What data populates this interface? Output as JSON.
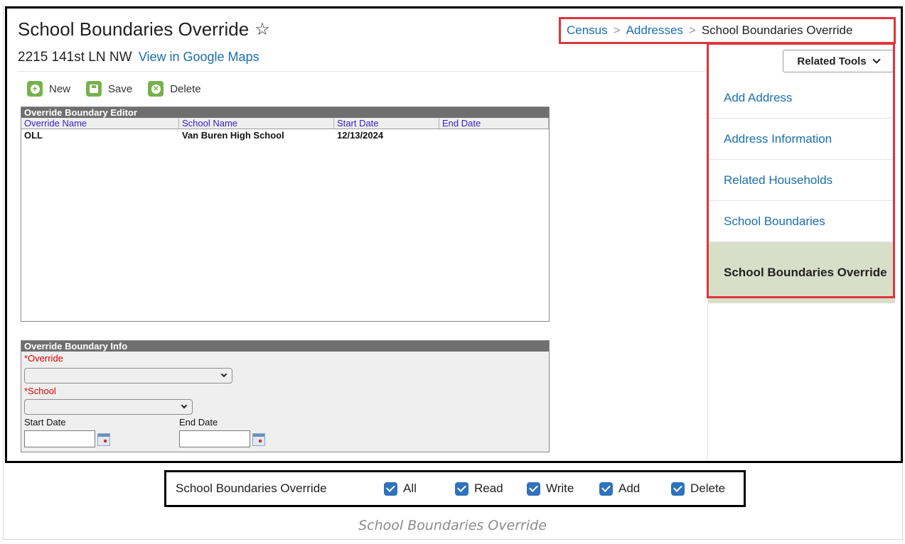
{
  "page": {
    "title": "School Boundaries Override",
    "address": "2215 141st LN NW",
    "maps_link": "View in Google Maps"
  },
  "breadcrumb": {
    "items": [
      "Census",
      "Addresses"
    ],
    "current": "School Boundaries Override"
  },
  "related_tools": {
    "button_label": "Related Tools",
    "items": [
      {
        "label": "Add Address"
      },
      {
        "label": "Address Information"
      },
      {
        "label": "Related Households"
      },
      {
        "label": "School Boundaries"
      },
      {
        "label": "School Boundaries Override",
        "active": true
      }
    ]
  },
  "toolbar": {
    "new_label": "New",
    "save_label": "Save",
    "delete_label": "Delete"
  },
  "editor": {
    "title": "Override Boundary Editor",
    "columns": [
      "Override Name",
      "School Name",
      "Start Date",
      "End Date"
    ],
    "rows": [
      [
        "OLL",
        "Van Buren High School",
        "12/13/2024",
        ""
      ]
    ]
  },
  "info": {
    "title": "Override Boundary Info",
    "override_label": "*Override",
    "school_label": "*School",
    "start_date_label": "Start Date",
    "end_date_label": "End Date",
    "override_value": "",
    "school_value": "",
    "start_date_value": "",
    "end_date_value": ""
  },
  "permissions": {
    "tool_name": "School Boundaries Override",
    "items": [
      {
        "label": "All",
        "checked": true
      },
      {
        "label": "Read",
        "checked": true
      },
      {
        "label": "Write",
        "checked": true
      },
      {
        "label": "Add",
        "checked": true
      },
      {
        "label": "Delete",
        "checked": true
      }
    ]
  },
  "caption": "School Boundaries Override",
  "colors": {
    "link": "#1a6fb0",
    "highlight_border": "#e0353b",
    "toolbar_icon": "#77b14c",
    "active_menu_bg": "#d8dfc9",
    "checkbox": "#2f72bd",
    "required_label": "#e00000"
  }
}
